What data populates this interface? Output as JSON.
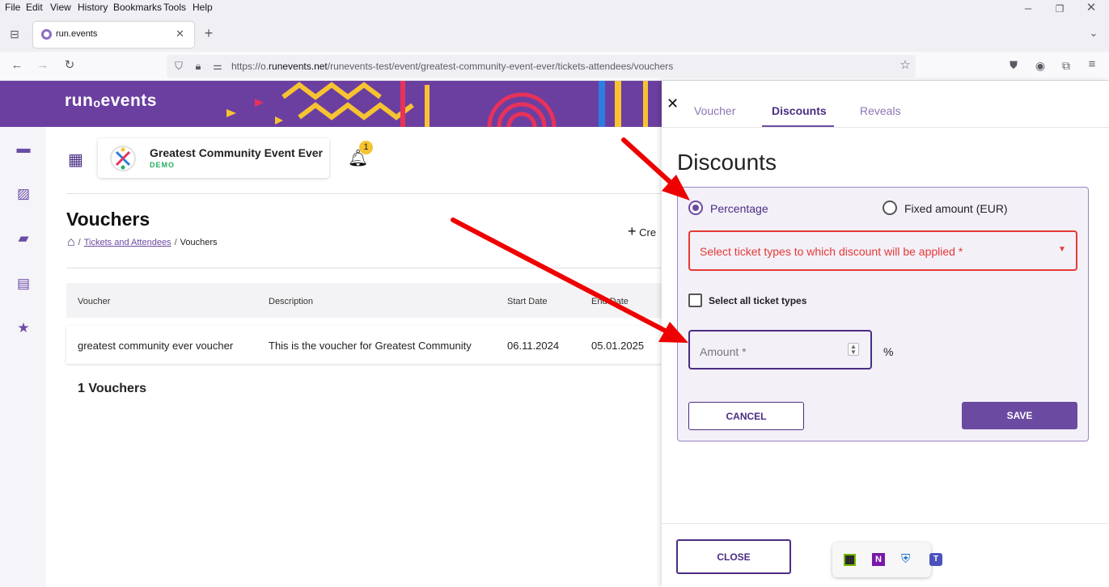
{
  "browser": {
    "menu": [
      "File",
      "Edit",
      "View",
      "History",
      "Bookmarks",
      "Tools",
      "Help"
    ],
    "tab_title": "run.events",
    "url_prefix": "https://o.",
    "url_host": "runevents.net",
    "url_path": "/runevents-test/event/greatest-community-event-ever/tickets-attendees/vouchers"
  },
  "app": {
    "logo": "run⁠ₒevents",
    "event_name": "Greatest Community Event Ever",
    "event_badge": "DEMO",
    "notification_count": "1"
  },
  "page": {
    "title": "Vouchers",
    "breadcrumb": {
      "sep": "/",
      "link": "Tickets and Attendees",
      "current": "Vouchers"
    },
    "create_label": "Cre",
    "table": {
      "headers": [
        "Voucher",
        "Description",
        "Start Date",
        "End Date"
      ],
      "rows": [
        [
          "greatest community ever voucher",
          "This is the voucher for Greatest Community",
          "06.11.2024",
          "05.01.2025"
        ]
      ]
    },
    "count_label": "1 Vouchers"
  },
  "drawer": {
    "tabs": [
      "Voucher",
      "Discounts",
      "Reveals"
    ],
    "active_tab": "Discounts",
    "heading": "Discounts",
    "radio_percentage": "Percentage",
    "radio_fixed": "Fixed amount (EUR)",
    "ticket_select_placeholder": "Select ticket types to which discount will be applied *",
    "select_all_label": "Select all ticket types",
    "amount_placeholder": "Amount *",
    "amount_unit": "%",
    "cancel_label": "CANCEL",
    "save_label": "SAVE",
    "close_label": "CLOSE"
  },
  "colors": {
    "brand_purple": "#6b3fa0",
    "accent_purple": "#6b4ba1",
    "error_red": "#e53935",
    "annotation_red": "#ee0000"
  }
}
